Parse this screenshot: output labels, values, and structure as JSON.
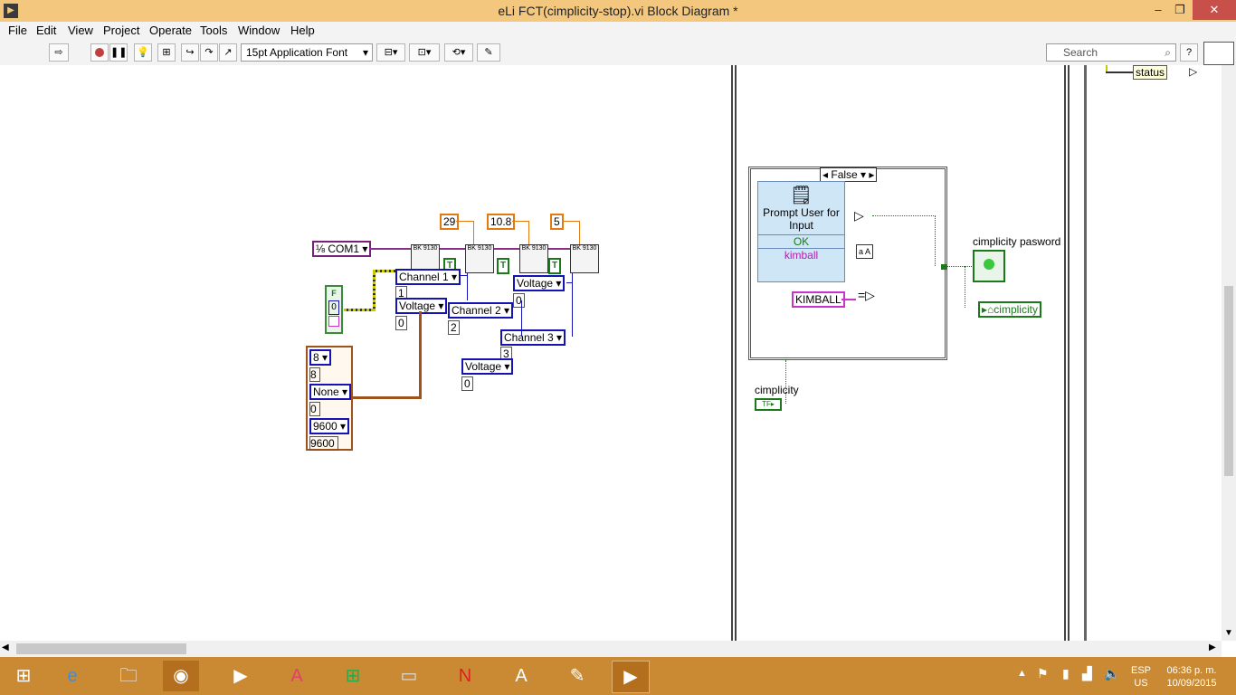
{
  "window": {
    "title": "eLi FCT(cimplicity-stop).vi Block Diagram *"
  },
  "menu": [
    "File",
    "Edit",
    "View",
    "Project",
    "Operate",
    "Tools",
    "Window",
    "Help"
  ],
  "toolbar": {
    "font": "15pt Application Font",
    "search_placeholder": "Search"
  },
  "diagram": {
    "com_port": "COM1",
    "setpoints": [
      "29",
      "10.8",
      "5"
    ],
    "true_const": "T",
    "false_const": "F",
    "zero": "0",
    "channels": [
      {
        "name": "Channel 1",
        "index": "1",
        "mode": "Voltage",
        "mode_val": "0"
      },
      {
        "name": "Channel 2",
        "index": "2",
        "mode": "Voltage",
        "mode_val": "0"
      },
      {
        "name": "Channel 3",
        "index": "3",
        "mode": "Voltage",
        "mode_val": "0"
      }
    ],
    "serial": {
      "data_bits_enum": "8",
      "data_bits": "8",
      "parity_enum": "None",
      "parity_val": "0",
      "baud_enum": "9600",
      "baud": "9600"
    },
    "instrument": "BK 9130",
    "case_selector": "False",
    "prompt_title": "Prompt User for Input",
    "prompt_ok": "OK",
    "prompt_input": "kimball",
    "kimball_const": "KIMBALL",
    "indicator_label": "cimplicity pasword",
    "property_node": "cimplicity",
    "local_var": "cimplicity",
    "status": "status"
  },
  "taskbar": {
    "lang": "ESP",
    "layout": "US",
    "time": "06:36 p. m.",
    "date": "10/09/2015"
  }
}
